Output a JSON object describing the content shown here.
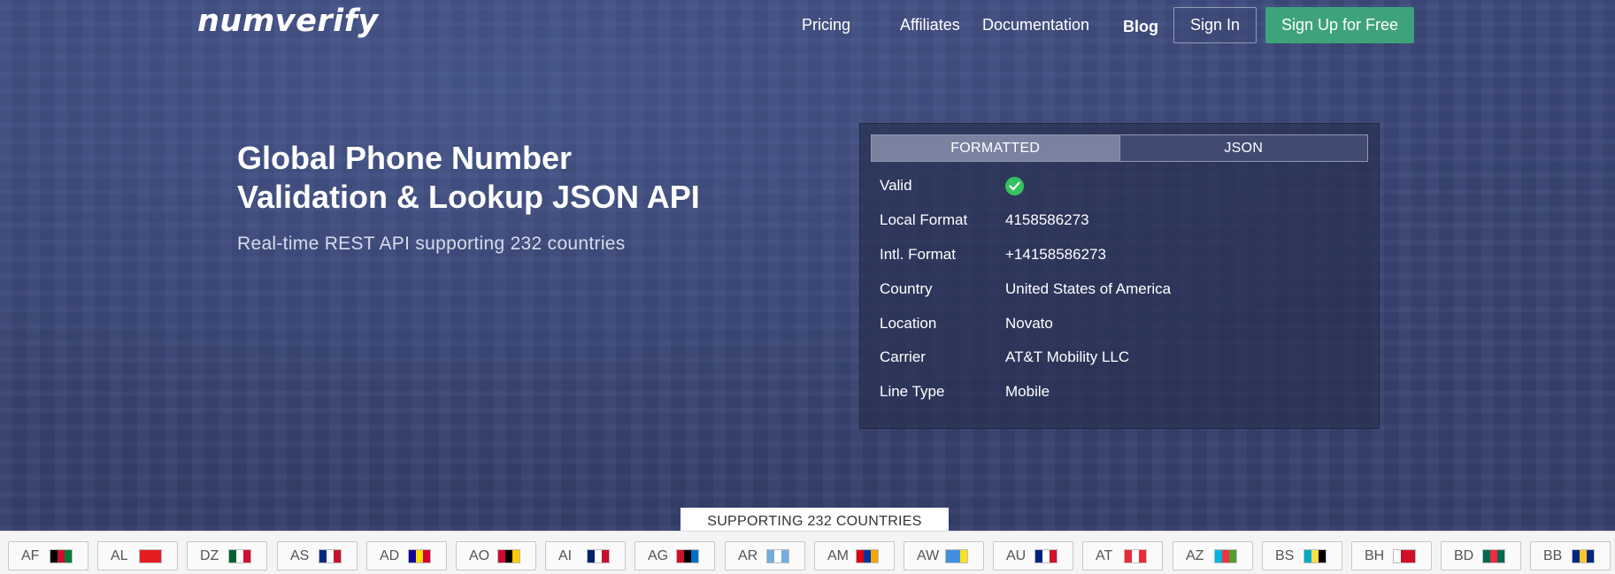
{
  "header": {
    "logo": "numverify",
    "nav": {
      "pricing": "Pricing",
      "affiliates": "Affiliates",
      "documentation": "Documentation",
      "blog": "Blog"
    },
    "sign_in": "Sign In",
    "sign_up": "Sign Up for Free"
  },
  "hero": {
    "title_line1": "Global Phone Number",
    "title_line2": "Validation & Lookup JSON API",
    "subtitle": "Real-time REST API supporting 232 countries"
  },
  "panel": {
    "tabs": {
      "formatted": "FORMATTED",
      "json": "JSON",
      "active": "FORMATTED"
    },
    "rows": [
      {
        "label": "Valid",
        "value": "",
        "icon": "check-circle-icon"
      },
      {
        "label": "Local Format",
        "value": "4158586273"
      },
      {
        "label": "Intl. Format",
        "value": "+14158586273"
      },
      {
        "label": "Country",
        "value": "United States of America"
      },
      {
        "label": "Location",
        "value": "Novato"
      },
      {
        "label": "Carrier",
        "value": "AT&T Mobility LLC"
      },
      {
        "label": "Line Type",
        "value": "Mobile"
      }
    ]
  },
  "support_label": "SUPPORTING 232 COUNTRIES",
  "countries": [
    {
      "code": "AF",
      "flag_colors": [
        "#000000",
        "#c8102e",
        "#007a36"
      ]
    },
    {
      "code": "AL",
      "flag_colors": [
        "#e41e20",
        "#e41e20",
        "#e41e20"
      ]
    },
    {
      "code": "DZ",
      "flag_colors": [
        "#006233",
        "#ffffff",
        "#d21034"
      ]
    },
    {
      "code": "AS",
      "flag_colors": [
        "#002b7f",
        "#ffffff",
        "#c8102e"
      ]
    },
    {
      "code": "AD",
      "flag_colors": [
        "#10069f",
        "#fedd00",
        "#d50032"
      ]
    },
    {
      "code": "AO",
      "flag_colors": [
        "#cc092f",
        "#000000",
        "#ffcb00"
      ]
    },
    {
      "code": "AI",
      "flag_colors": [
        "#012169",
        "#ffffff",
        "#c8102e"
      ]
    },
    {
      "code": "AG",
      "flag_colors": [
        "#ce1126",
        "#000000",
        "#0072c6"
      ]
    },
    {
      "code": "AR",
      "flag_colors": [
        "#74acdf",
        "#ffffff",
        "#74acdf"
      ]
    },
    {
      "code": "AM",
      "flag_colors": [
        "#d90012",
        "#0033a0",
        "#f2a800"
      ]
    },
    {
      "code": "AW",
      "flag_colors": [
        "#418fde",
        "#418fde",
        "#fbe122"
      ]
    },
    {
      "code": "AU",
      "flag_colors": [
        "#00247d",
        "#ffffff",
        "#cf142b"
      ]
    },
    {
      "code": "AT",
      "flag_colors": [
        "#ed2939",
        "#ffffff",
        "#ed2939"
      ]
    },
    {
      "code": "AZ",
      "flag_colors": [
        "#00b5e2",
        "#ef3340",
        "#509e2f"
      ]
    },
    {
      "code": "BS",
      "flag_colors": [
        "#00abc9",
        "#fae042",
        "#000000"
      ]
    },
    {
      "code": "BH",
      "flag_colors": [
        "#ffffff",
        "#ce1126",
        "#ce1126"
      ]
    },
    {
      "code": "BD",
      "flag_colors": [
        "#006a4e",
        "#f42a41",
        "#006a4e"
      ]
    },
    {
      "code": "BB",
      "flag_colors": [
        "#00267f",
        "#ffc726",
        "#00267f"
      ]
    }
  ],
  "colors": {
    "accent_green": "#3ea37b",
    "valid_check": "#34c25f",
    "hero_bg": "#3a4675"
  }
}
